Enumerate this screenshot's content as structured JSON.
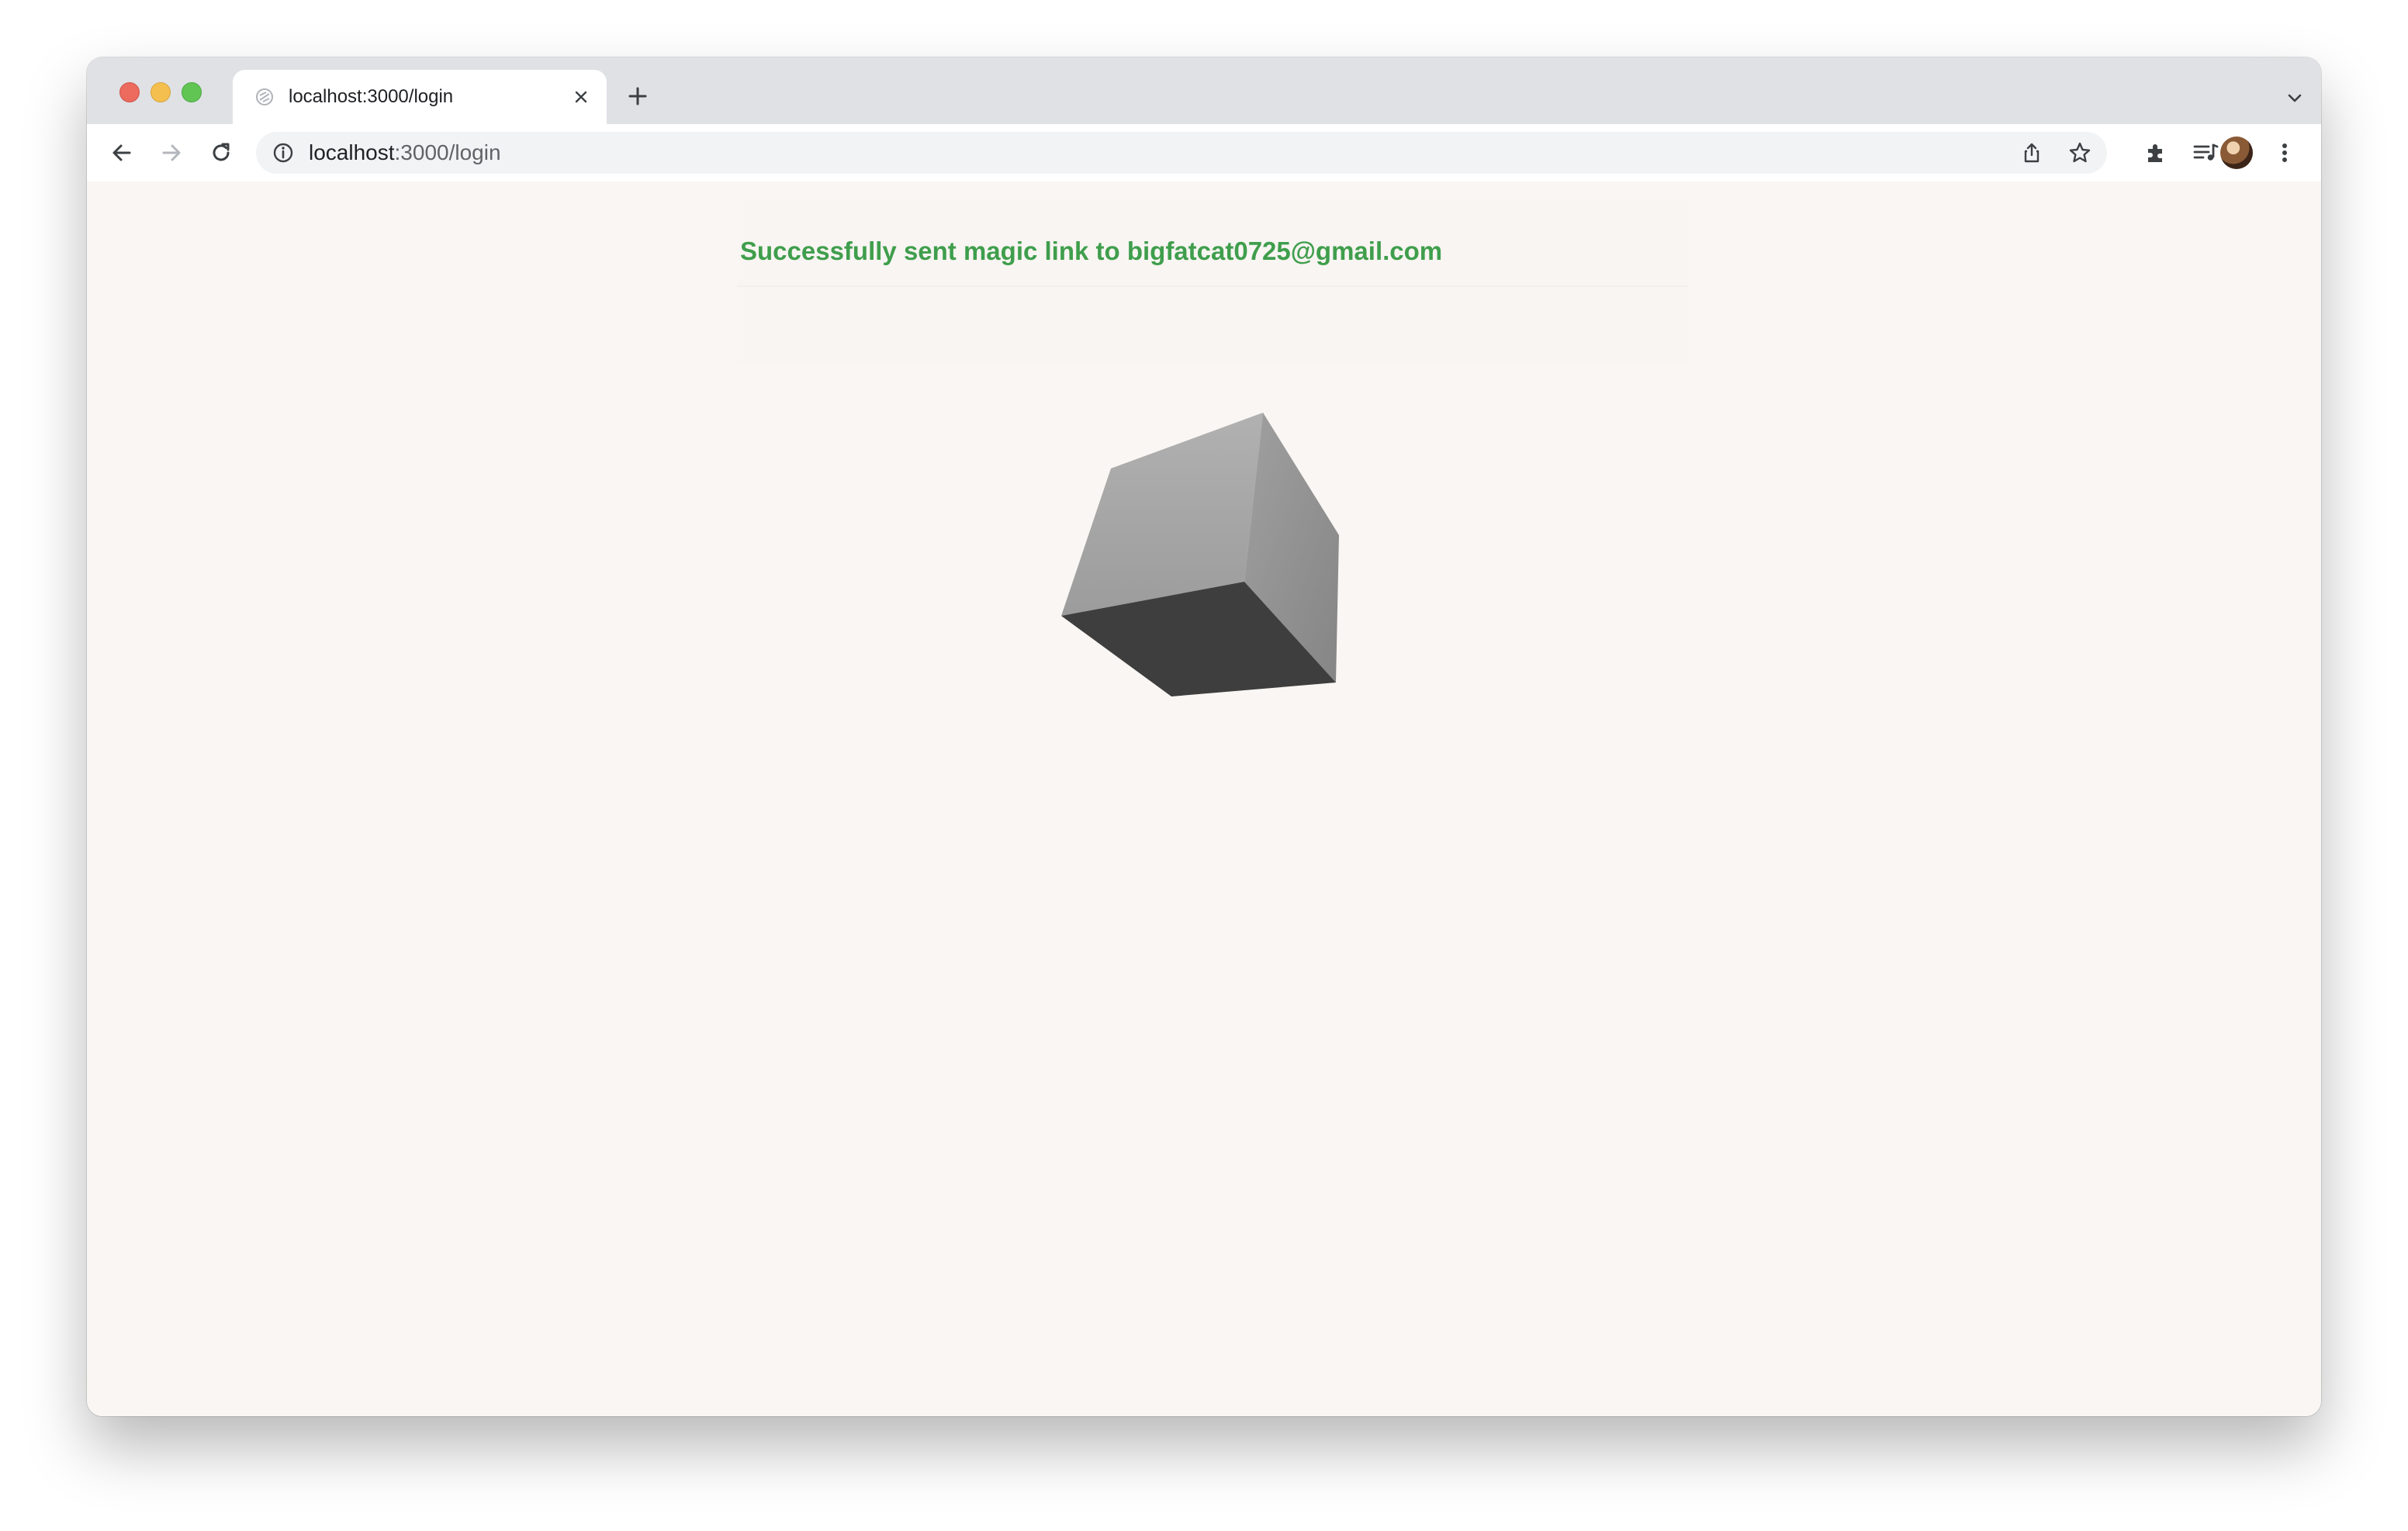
{
  "browser": {
    "tab": {
      "title": "localhost:3000/login"
    },
    "address": {
      "host": "localhost",
      "path": ":3000/login"
    },
    "icons": {
      "favicon": "globe-icon",
      "close": "close-icon",
      "new_tab": "plus-icon",
      "tab_menu": "chevron-down-icon",
      "back": "back-arrow-icon",
      "forward": "forward-arrow-icon",
      "reload": "reload-icon",
      "site_info": "info-icon",
      "share": "share-icon",
      "bookmark": "star-icon",
      "extensions": "puzzle-icon",
      "media": "media-queue-icon",
      "profile": "avatar",
      "menu": "more-vertical-icon"
    }
  },
  "page": {
    "message": "Successfully sent magic link to bigfatcat0725@gmail.com",
    "message_color": "#3f9e4c",
    "background": "#faf6f3",
    "graphic": "rotating-cube"
  }
}
